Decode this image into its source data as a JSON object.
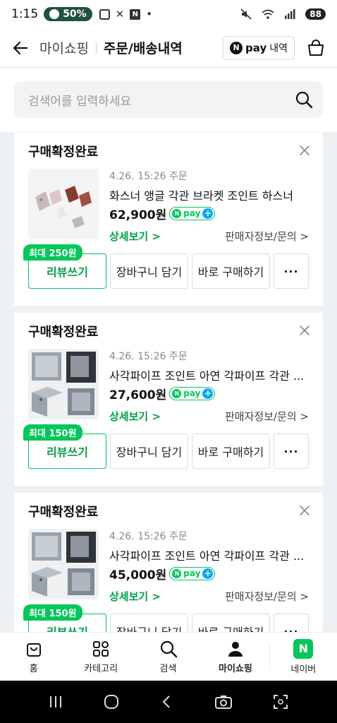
{
  "status_bar": {
    "time": "1:15",
    "battery_pill": "50%",
    "battery_level": "88"
  },
  "header": {
    "back_label": "마이쇼핑",
    "title": "주문/배송내역",
    "npay_n": "N",
    "npay_pay": "pay",
    "npay_history": "내역"
  },
  "search": {
    "placeholder": "검색어를 입력하세요"
  },
  "orders": [
    {
      "status": "구매확정완료",
      "date": "4.26. 15:26 주문",
      "name": "화스너 앵글 각관 브라켓 조인트 하스너",
      "price": "62,900원",
      "detail_link": "상세보기 >",
      "seller_link": "판매자정보/문의 >",
      "reward": "최대 250원",
      "review_btn": "리뷰쓰기",
      "cart_btn": "장바구니 담기",
      "buy_btn": "바로 구매하기",
      "more_btn": "···"
    },
    {
      "status": "구매확정완료",
      "date": "4.26. 15:26 주문",
      "name": "사각파이프 조인트 아연 각파이프 각관 ...",
      "price": "27,600원",
      "detail_link": "상세보기 >",
      "seller_link": "판매자정보/문의 >",
      "reward": "최대 150원",
      "review_btn": "리뷰쓰기",
      "cart_btn": "장바구니 담기",
      "buy_btn": "바로 구매하기",
      "more_btn": "···"
    },
    {
      "status": "구매확정완료",
      "date": "4.26. 15:26 주문",
      "name": "사각파이프 조인트 아연 각파이프 각관 ...",
      "price": "45,000원",
      "detail_link": "상세보기 >",
      "seller_link": "판매자정보/문의 >",
      "reward": "최대 150원",
      "review_btn": "리뷰쓰기",
      "cart_btn": "장바구니 담기",
      "buy_btn": "바로 구매하기",
      "more_btn": "···"
    }
  ],
  "npay_badge": {
    "n": "N",
    "pay": "pay",
    "plus": "+"
  },
  "bottom_nav": {
    "home": "홈",
    "category": "카테고리",
    "search": "검색",
    "myshopping": "마이쇼핑",
    "naver": "네이버",
    "naver_logo": "N"
  },
  "colors": {
    "accent": "#03c75a",
    "accent_text": "#03a04a",
    "battery_pill": "#1f5146"
  }
}
